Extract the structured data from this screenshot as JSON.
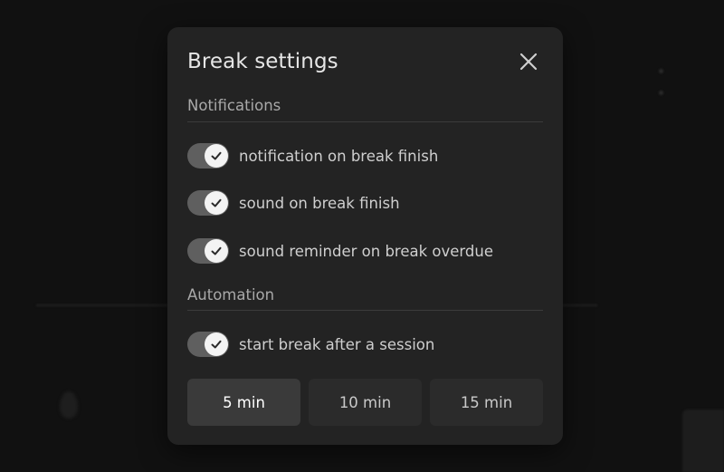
{
  "dialog": {
    "title": "Break settings",
    "close_icon": "close-icon",
    "sections": [
      {
        "header": "Notifications",
        "toggles": [
          {
            "label": "notification on break finish",
            "on": true
          },
          {
            "label": "sound on break finish",
            "on": true
          },
          {
            "label": "sound reminder on break overdue",
            "on": true
          }
        ]
      },
      {
        "header": "Automation",
        "toggles": [
          {
            "label": "start break after a session",
            "on": true
          }
        ]
      }
    ],
    "durations": [
      {
        "label": "5 min",
        "selected": true
      },
      {
        "label": "10 min",
        "selected": false
      },
      {
        "label": "15 min",
        "selected": false
      }
    ]
  },
  "colors": {
    "dialog_bg": "#232323",
    "toggle_track": "#5f5f5f",
    "toggle_knob": "#f3f3f3",
    "selected_button": "#3a3a3a",
    "button": "#2b2b2b"
  }
}
